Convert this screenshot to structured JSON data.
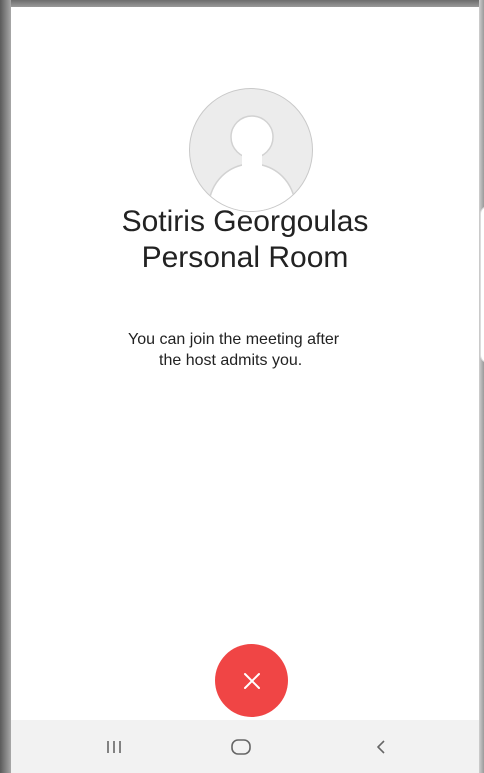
{
  "meeting": {
    "title_line1": "Sotiris Georgoulas",
    "title_line2": "Personal Room",
    "message_line1": "You can join the meeting after",
    "message_line2": "the host admits you."
  },
  "avatar": {
    "icon": "default-user-avatar-icon"
  },
  "actions": {
    "leave_icon": "close-icon",
    "leave_color": "#f04545"
  },
  "nav_bar": {
    "recent_icon": "recent-apps-icon",
    "home_icon": "home-icon",
    "back_icon": "back-icon"
  },
  "colors": {
    "text": "#222222",
    "avatar_bg": "#ececec",
    "avatar_figure": "#cfcfcf",
    "nav_bg": "#f2f2f2"
  }
}
